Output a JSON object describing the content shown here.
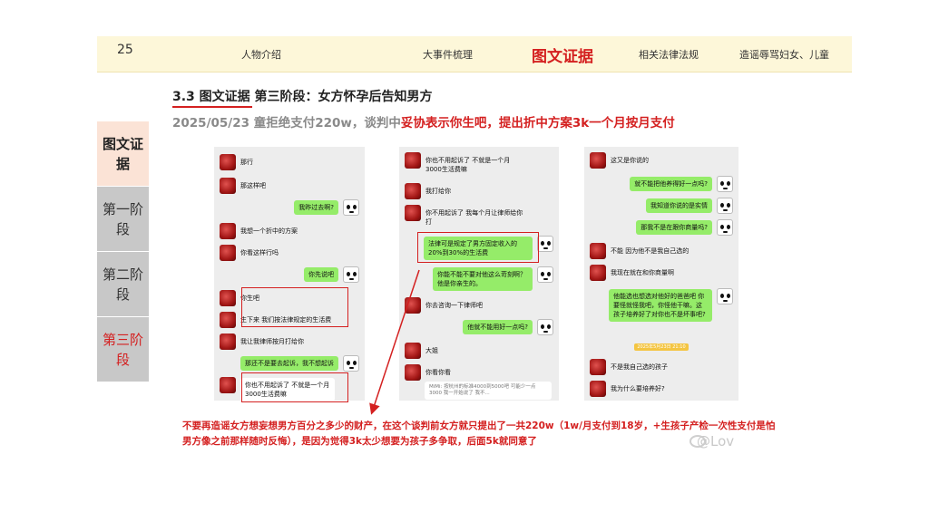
{
  "header": {
    "page_number": "25",
    "tabs": [
      "人物介绍",
      "大事件梳理",
      "图文证据",
      "相关法律法规",
      "造谣辱骂妇女、儿童"
    ],
    "active_tab": "图文证据"
  },
  "slide": {
    "title": "3.3 图文证据 第三阶段：女方怀孕后告知男方",
    "subtitle_gray": "2025/05/23  童拒绝支付220w，谈判中",
    "subtitle_red": "妥协表示你生吧，提出折中方案3k一个月按月支付"
  },
  "side_nav": {
    "items": [
      "图文证据",
      "第一阶段",
      "第二阶段",
      "第三阶段"
    ]
  },
  "chat1": {
    "m1": "那行",
    "m2": "那这样吧",
    "m3": "我昨过去啊?",
    "m4": "我想一个折中的方案",
    "m5": "你看这样行吗",
    "m6": "你先说吧",
    "m7": "你生吧",
    "m8": "生下来 我们按法律规定的生活费",
    "m9": "我让我律师按月打给你",
    "m10": "那还不是要去起诉，我不想起诉",
    "m11": "你也不用起诉了 不就是一个月3000生活费嘛"
  },
  "chat2": {
    "m1": "你也不用起诉了 不就是一个月3000生活费嘛",
    "m2": "我打给你",
    "m3": "你不用起诉了 我每个月让律师给你打",
    "m4": "法律可是规定了男方固定收入的20%到30%的生活费",
    "m5": "你能不能不要对他这么苛刻啊？他是你亲生的。",
    "m6": "你去咨询一下律师吧",
    "m7": "他就不能用好一点吗?",
    "m8": "大姐",
    "m9": "你看你看",
    "m10": "MiMi: 按杭州的标准4000到5000吧 可能少一点3000 我一开始说了 我不..."
  },
  "chat3": {
    "m1": "这又是你说的",
    "m2": "就不能把他养得好一点吗?",
    "m3": "我知道你说的是实情",
    "m4": "那我不是在跟你商量吗?",
    "m5": "不能 因为他不是我自己选的",
    "m6": "我现在就在和你商量啊",
    "m7": "他能选也想选对他好的爸爸吧 你要怪就怪我吧，你怪他干嘛。这孩子培养好了对你也不是坏事吧?",
    "m8": "不是我自己选的孩子",
    "m9": "我为什么要培养好?",
    "timestamp": "2025年5月23日 21:10"
  },
  "bottom_note": "不要再造谣女方想妄想男方百分之多少的财产，在这个谈判前女方就只提出了一共220w（1w/月支付到18岁，+生孩子产检一次性支付是怕男方像之前那样随时反悔），是因为觉得3k太少想要为孩子多争取，后面5k就同意了",
  "watermark": "@Lov",
  "colors": {
    "accent_red": "#d42020",
    "header_bg": "#fdf7d9",
    "bubble_green": "#95ec69",
    "side_active_bg": "#fbe3d6",
    "side_inactive_bg": "#c8c8c8"
  }
}
